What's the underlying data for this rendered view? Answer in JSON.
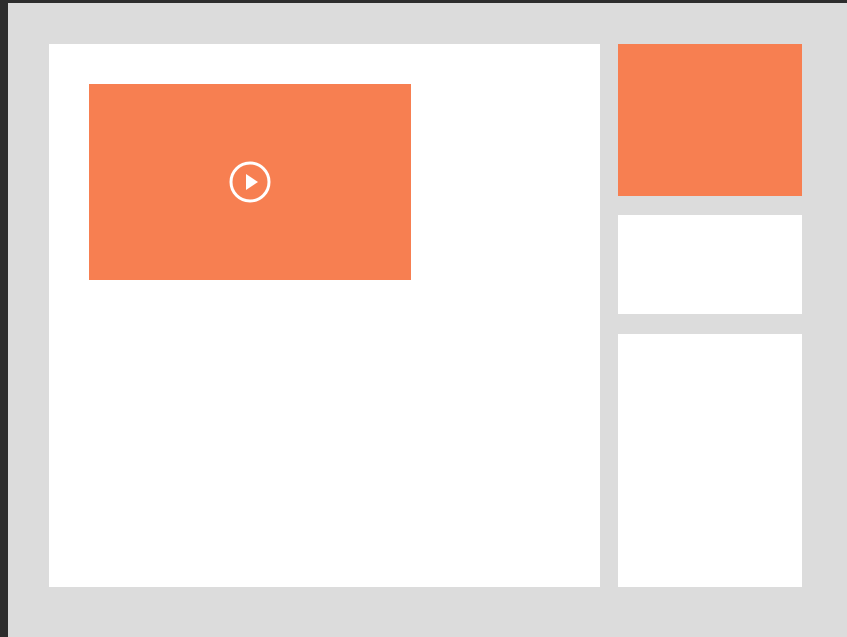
{
  "colors": {
    "frame": "#2d2d2d",
    "canvas_background": "#dcdcdc",
    "panel_background": "#ffffff",
    "accent": "#f77f51",
    "icon": "#ffffff"
  },
  "main_panel": {
    "video_placeholder": {
      "icon": "play-circle-icon"
    }
  },
  "sidebar": {
    "cards": [
      {
        "fill": "#f77f51"
      },
      {
        "fill": "#ffffff"
      },
      {
        "fill": "#ffffff"
      }
    ]
  }
}
